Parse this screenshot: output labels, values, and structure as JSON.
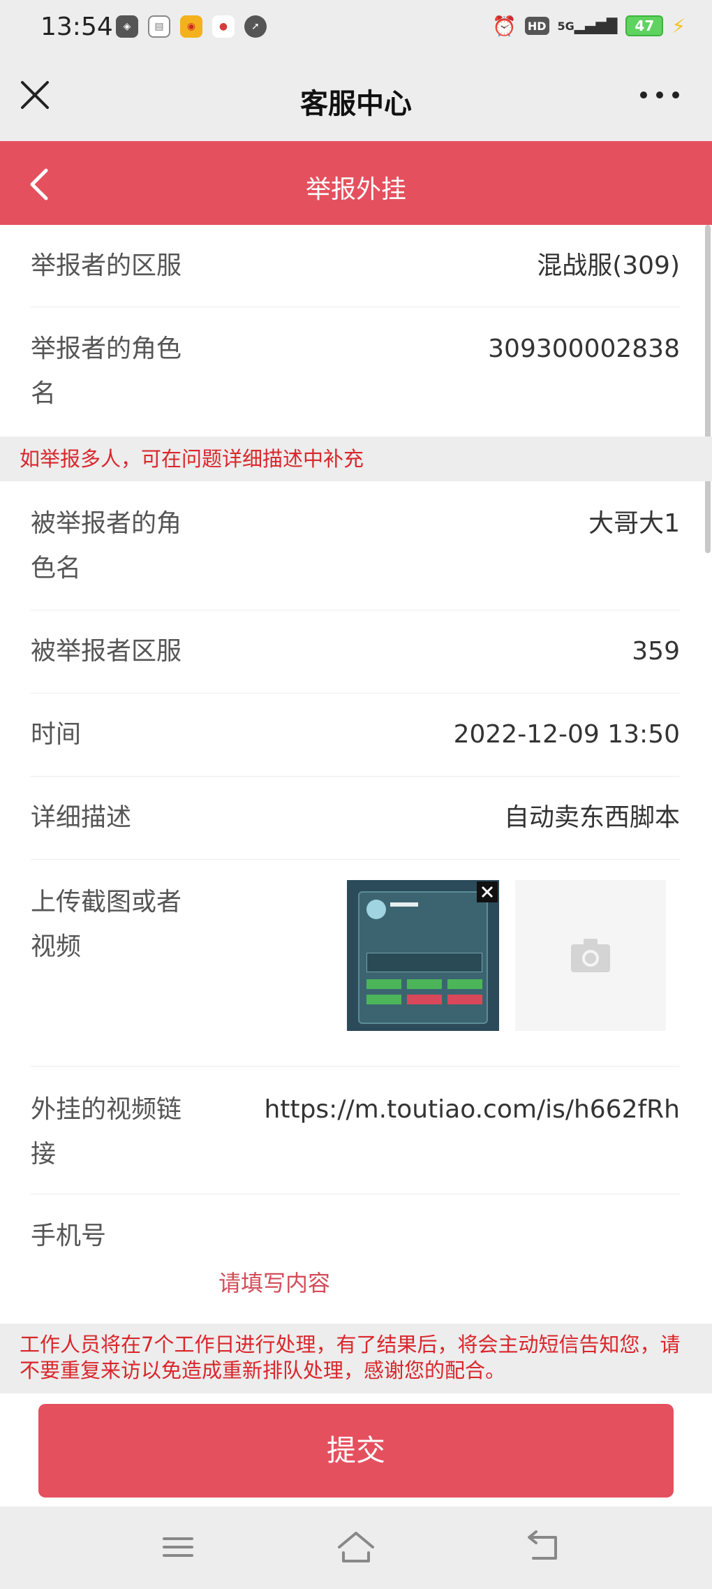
{
  "status_bar": {
    "time": "13:54",
    "network": "5G",
    "hd": "HD",
    "battery": "47"
  },
  "header": {
    "title": "客服中心"
  },
  "nav": {
    "title": "举报外挂"
  },
  "form": {
    "reporter_server": {
      "label": "举报者的区服",
      "value": "混战服(309)"
    },
    "reporter_role": {
      "label": "举报者的角色名",
      "value": "309300002838"
    },
    "notice_multi": "如举报多人，可在问题详细描述中补充",
    "reported_role": {
      "label": "被举报者的角色名",
      "value": "大哥大1"
    },
    "reported_server": {
      "label": "被举报者区服",
      "value": "359"
    },
    "time": {
      "label": "时间",
      "value": "2022-12-09 13:50"
    },
    "description": {
      "label": "详细描述",
      "value": "自动卖东西脚本"
    },
    "upload": {
      "label": "上传截图或者视频"
    },
    "video_link": {
      "label": "外挂的视频链接",
      "value": "https://m.toutiao.com/is/h662fRh"
    },
    "phone": {
      "label": "手机号",
      "placeholder": "请填写内容"
    }
  },
  "footer_notice": "工作人员将在7个工作日进行处理，有了结果后，将会主动短信告知您，请不要重复来访以免造成重新排队处理，感谢您的配合。",
  "submit_label": "提交",
  "colors": {
    "accent": "#e5505e",
    "notice_text": "#d9262c",
    "background_gray": "#ededed"
  }
}
